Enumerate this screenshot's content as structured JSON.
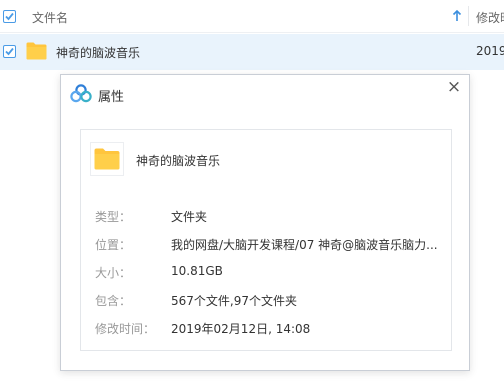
{
  "list": {
    "header": {
      "name_label": "文件名",
      "modified_label": "修改时"
    },
    "rows": [
      {
        "name": "神奇的脑波音乐",
        "date": "2019",
        "checked": true
      }
    ]
  },
  "dialog": {
    "title": "属性",
    "close_glyph": "×",
    "item_name": "神奇的脑波音乐",
    "properties": [
      {
        "label": "类型：",
        "value": "文件夹"
      },
      {
        "label": "位置：",
        "value": "我的网盘/大脑开发课程/07 神奇@脑波音乐脑力..."
      },
      {
        "label": "大小：",
        "value": "10.81GB"
      },
      {
        "label": "包含：",
        "value": "567个文件,97个文件夹"
      },
      {
        "label": "修改时间：",
        "value": "2019年02月12日, 14:08"
      }
    ]
  },
  "colors": {
    "accent": "#4a9be6",
    "selected_row": "#e9f3fc",
    "folder": "#ffc53d",
    "label_gray": "#999999"
  },
  "icons": {
    "header_checkbox": "checkbox-checked-icon",
    "sort": "sort-ascending-icon",
    "folder": "folder-icon",
    "dialog_logo": "baidu-cloud-logo-icon",
    "close": "close-icon"
  }
}
